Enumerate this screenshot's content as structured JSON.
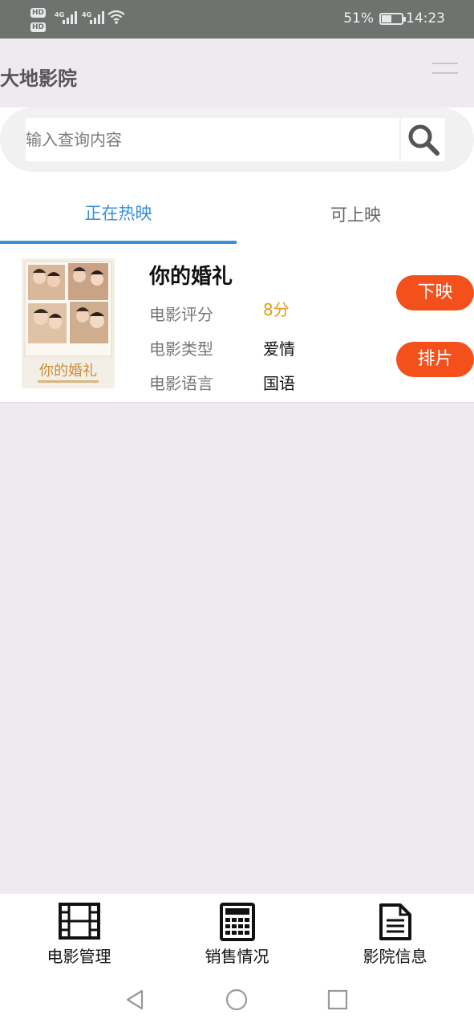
{
  "status_bar": {
    "hd1": "HD",
    "hd2": "HD",
    "net1": "4G",
    "net2": "4G",
    "battery_pct": "51%",
    "battery_level": 0.51,
    "time": "14:23"
  },
  "app_bar": {
    "title": "大地影院",
    "menu_icon": "hamburger-icon"
  },
  "search": {
    "placeholder": "输入查询内容",
    "value": "",
    "icon": "search-icon"
  },
  "tabs": [
    {
      "label": "正在热映",
      "active": true
    },
    {
      "label": "可上映",
      "active": false
    }
  ],
  "movie": {
    "title": "你的婚礼",
    "rating_label": "电影评分",
    "rating_value": "8分",
    "genre_label": "电影类型",
    "genre_value": "爱情",
    "language_label": "电影语言",
    "language_value": "国语",
    "btn_offline": "下映",
    "btn_schedule": "排片",
    "poster_title_art": "你的婚礼"
  },
  "bottom_nav": [
    {
      "label": "电影管理",
      "icon": "film-icon"
    },
    {
      "label": "销售情况",
      "icon": "calculator-icon"
    },
    {
      "label": "影院信息",
      "icon": "document-icon"
    }
  ],
  "system_nav": {
    "back": "back-triangle-icon",
    "home": "home-circle-icon",
    "recents": "recents-square-icon"
  },
  "colors": {
    "accent_tab": "#3a8fd8",
    "action_button": "#f4501c",
    "rating": "#e69a1a",
    "background": "#efeaef"
  }
}
